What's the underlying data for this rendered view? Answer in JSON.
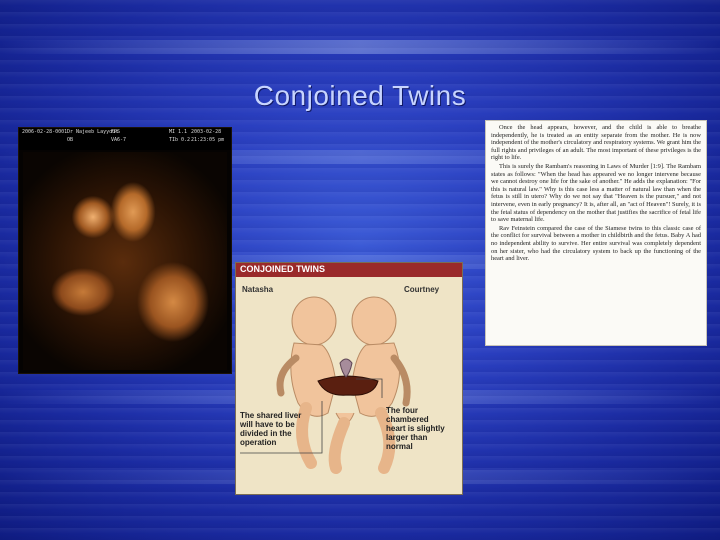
{
  "slide": {
    "title": "Conjoined Twins"
  },
  "ultrasound": {
    "header": {
      "date": "2006-02-28-0001",
      "doctor": "Dr Najeeb Layyous",
      "mode": "FPS",
      "m_value": "MI 1.1",
      "date2": "2003-02-28",
      "dept": "OB",
      "probe": "VA6-7",
      "tib": "TIb 0.2",
      "time": "21:23:05 pm"
    }
  },
  "diagram": {
    "title": "CONJOINED TWINS",
    "left_name": "Natasha",
    "right_name": "Courtney",
    "note_liver": [
      "The shared liver",
      "will have to be",
      "divided in the",
      "operation"
    ],
    "note_heart": [
      "The four",
      "chambered",
      "heart is slightly",
      "larger than",
      "normal"
    ]
  },
  "excerpt": {
    "paragraphs": [
      "Once the head appears, however, and the child is able to breathe independently, he is treated as an entity separate from the mother. He is now independent of the mother's circulatory and respiratory systems. We grant him the full rights and privileges of an adult. The most important of these privileges is the right to life.",
      "This is surely the Rambam's reasoning in Laws of Murder [1:9]. The Rambam states as follows: \"When the head has appeared we no longer intervene because we cannot destroy one life for the sake of another.\" He adds the explanation: \"For this is natural law.\" Why is this case less a matter of natural law than when the fetus is still in utero? Why do we not say that \"Heaven is the pursuer,\" and not intervene, even in early pregnancy? It is, after all, an \"act of Heaven\"! Surely, it is the fetal status of dependency on the mother that justifies the sacrifice of fetal life to save maternal life.",
      "Rav Feinstein compared the case of the Siamese twins to this classic case of the conflict for survival between a mother in childbirth and the fetus. Baby A had no independent ability to survive. Her entire survival was completely dependent on her sister, who had the circulatory system to back up the functioning of the heart and liver."
    ]
  }
}
